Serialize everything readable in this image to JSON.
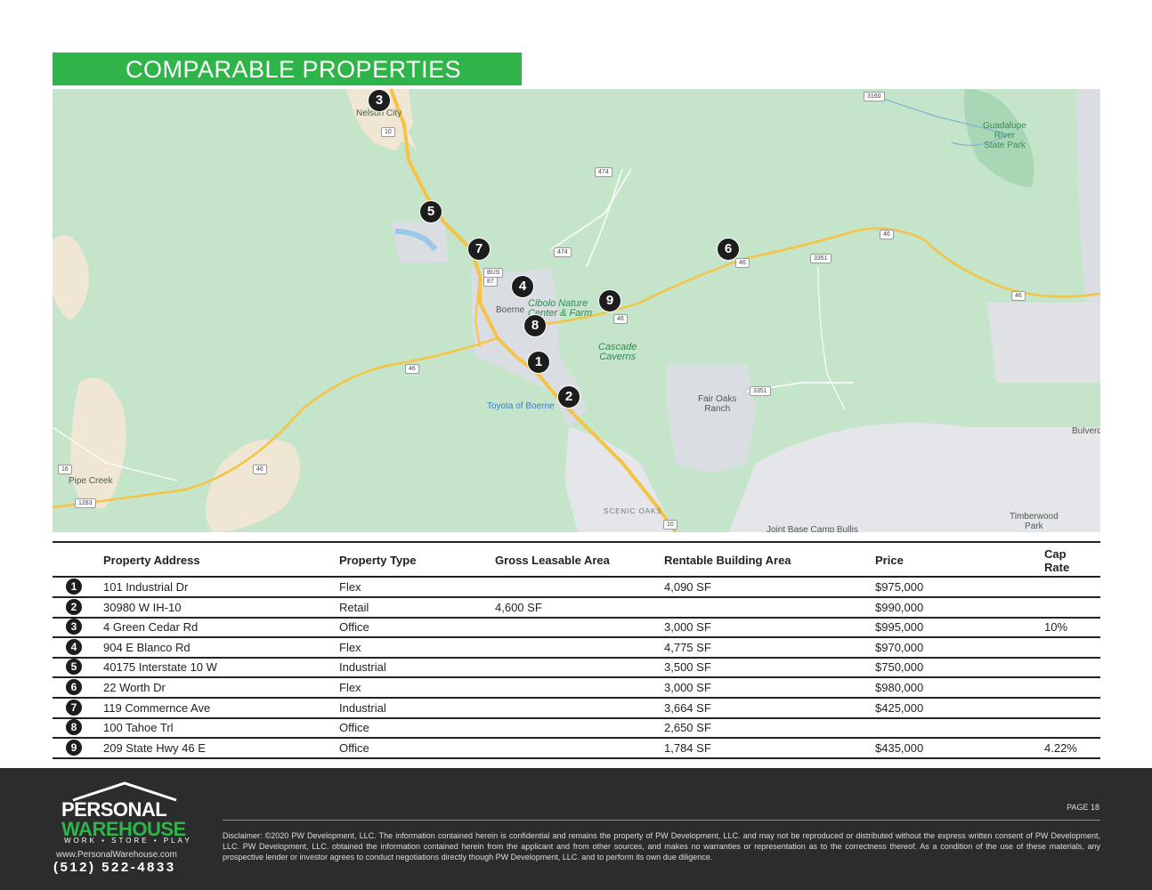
{
  "header": {
    "title": "COMPARABLE PROPERTIES"
  },
  "map": {
    "labels": {
      "nelson_city": "Nelson City",
      "guadalupe": "Guadalupe\nRiver\nState Park",
      "boerne": "Boerne",
      "cibolo": "Cibolo Nature\nCenter & Farm",
      "cascade": "Cascade\nCaverns",
      "fair_oaks": "Fair Oaks\nRanch",
      "toyota": "Toyota of Boerne",
      "pipe_creek": "Pipe Creek",
      "scenic_oaks": "SCENIC OAKS",
      "camp_bullis": "Joint Base Camp Bullis",
      "timberwood": "Timberwood\nPark",
      "bulverde": "Bulverd"
    },
    "road_shields": [
      "3160",
      "10",
      "474",
      "474",
      "87",
      "BUS",
      "46",
      "46",
      "3351",
      "46",
      "46",
      "3351",
      "46",
      "16",
      "46",
      "1283",
      "10"
    ],
    "markers": [
      "3",
      "5",
      "7",
      "4",
      "9",
      "8",
      "1",
      "2",
      "6"
    ]
  },
  "table": {
    "headers": {
      "address": "Property Address",
      "type": "Property Type",
      "gla": "Gross Leasable Area",
      "rba": "Rentable Building Area",
      "price": "Price",
      "cap": "Cap\nRate"
    },
    "rows": [
      {
        "num": "1",
        "address": "101 Industrial  Dr",
        "type": "Flex",
        "gla": "",
        "rba": "4,090 SF",
        "price": "$975,000",
        "cap": ""
      },
      {
        "num": "2",
        "address": "30980 W IH-10",
        "type": "Retail",
        "gla": "4,600 SF",
        "rba": "",
        "price": "$990,000",
        "cap": ""
      },
      {
        "num": "3",
        "address": "4 Green Cedar Rd",
        "type": "Office",
        "gla": "",
        "rba": "3,000 SF",
        "price": "$995,000",
        "cap": "10%"
      },
      {
        "num": "4",
        "address": "904 E Blanco Rd",
        "type": "Flex",
        "gla": "",
        "rba": "4,775 SF",
        "price": "$970,000",
        "cap": ""
      },
      {
        "num": "5",
        "address": "40175 Interstate 10 W",
        "type": "Industrial",
        "gla": "",
        "rba": "3,500 SF",
        "price": "$750,000",
        "cap": ""
      },
      {
        "num": "6",
        "address": "22 Worth Dr",
        "type": "Flex",
        "gla": "",
        "rba": "3,000 SF",
        "price": "$980,000",
        "cap": ""
      },
      {
        "num": "7",
        "address": "119 Commernce Ave",
        "type": "Industrial",
        "gla": "",
        "rba": "3,664 SF",
        "price": " $425,000",
        "cap": ""
      },
      {
        "num": "8",
        "address": "100 Tahoe Trl",
        "type": "Office",
        "gla": "",
        "rba": "2,650 SF",
        "price": "",
        "cap": ""
      },
      {
        "num": "9",
        "address": "209 State Hwy 46 E",
        "type": "Office",
        "gla": "",
        "rba": "1,784 SF",
        "price": "$435,000",
        "cap": "4.22%"
      }
    ]
  },
  "footer": {
    "logo_line1": "PERSONAL",
    "logo_line2": "WAREHOUSE",
    "logo_tagline": "WORK • STORE • PLAY",
    "website": "www.PersonalWarehouse.com",
    "phone": "(512) 522-4833",
    "page": "PAGE 18",
    "disclaimer": "Disclaimer: ©2020 PW Development, LLC. The information contained herein is confidential and remains the property of PW Development, LLC. and may not be reproduced or distributed without the express written consent of PW Development, LLC. PW Development, LLC. obtained the information contained herein from the applicant and from other sources, and makes no warranties or representation as to the correctness thereof. As a condition of the use of these materials, any prospective lender or investor agrees to conduct negotiations directly though PW Development, LLC. and to perform its own due diligence."
  },
  "colors": {
    "accent_green": "#2fb44a",
    "footer_bg": "#2c2c2c",
    "map_green": "#bfe2c5",
    "road": "#f5c542"
  }
}
